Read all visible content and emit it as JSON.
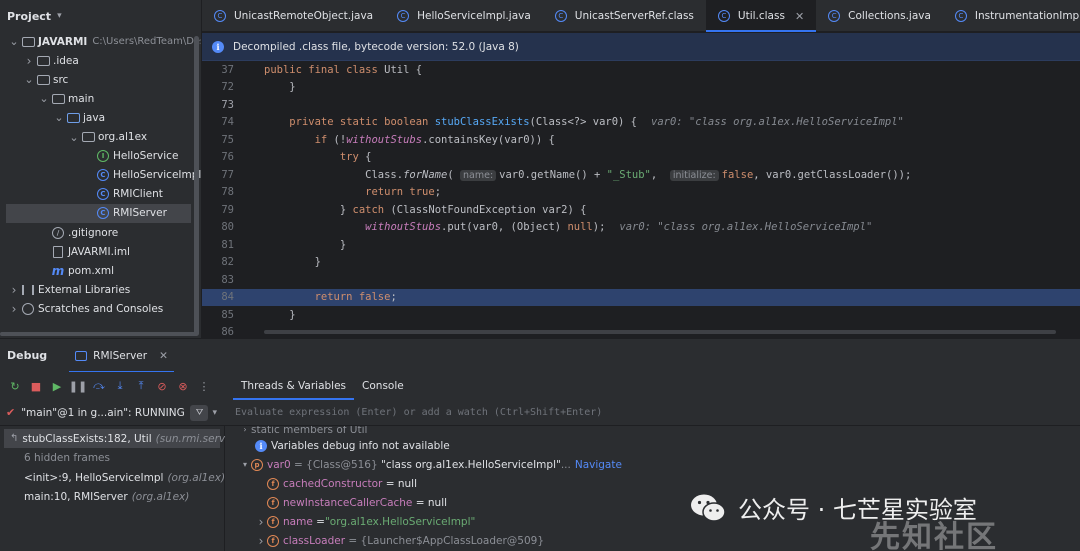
{
  "project": {
    "title": "Project",
    "tree": [
      {
        "label": "JAVARMI",
        "path": "C:\\Users\\RedTeam\\Desk",
        "icon": "folder-icon",
        "indent": 0,
        "arrow": "down"
      },
      {
        "label": ".idea",
        "icon": "folder-icon",
        "indent": 1,
        "arrow": "right"
      },
      {
        "label": "src",
        "icon": "folder-icon",
        "indent": 1,
        "arrow": "down"
      },
      {
        "label": "main",
        "icon": "folder-icon",
        "indent": 2,
        "arrow": "down"
      },
      {
        "label": "java",
        "icon": "source-folder-icon",
        "indent": 3,
        "arrow": "down"
      },
      {
        "label": "org.al1ex",
        "icon": "package-icon",
        "indent": 4,
        "arrow": "down"
      },
      {
        "label": "HelloService",
        "icon": "interface-icon",
        "indent": 5,
        "arrow": ""
      },
      {
        "label": "HelloServiceImpl",
        "icon": "class-icon",
        "indent": 5,
        "arrow": ""
      },
      {
        "label": "RMIClient",
        "icon": "class-icon",
        "indent": 5,
        "arrow": ""
      },
      {
        "label": "RMIServer",
        "icon": "class-icon",
        "indent": 5,
        "arrow": "",
        "selected": true
      },
      {
        "label": ".gitignore",
        "icon": "gitignore-icon",
        "indent": 2,
        "arrow": ""
      },
      {
        "label": "JAVARMI.iml",
        "icon": "file-icon",
        "indent": 2,
        "arrow": ""
      },
      {
        "label": "pom.xml",
        "icon": "maven-icon",
        "indent": 2,
        "arrow": ""
      },
      {
        "label": "External Libraries",
        "icon": "library-icon",
        "indent": 0,
        "arrow": "right"
      },
      {
        "label": "Scratches and Consoles",
        "icon": "scratches-icon",
        "indent": 0,
        "arrow": "right"
      }
    ]
  },
  "tabs": [
    {
      "label": "UnicastRemoteObject.java"
    },
    {
      "label": "HelloServiceImpl.java"
    },
    {
      "label": "UnicastServerRef.class"
    },
    {
      "label": "Util.class",
      "active": true
    },
    {
      "label": "Collections.java"
    },
    {
      "label": "InstrumentationImpl.class"
    }
  ],
  "banner": {
    "text": "Decompiled .class file, bytecode version: 52.0 (Java 8)"
  },
  "editor": {
    "lines": [
      {
        "n": "37",
        "html": "<span class='kw'>public final class</span> Util {"
      },
      {
        "n": "72",
        "html": "    }"
      },
      {
        "n": "73",
        "html": "",
        "current": true
      },
      {
        "n": "74",
        "html": "    <span class='kw'>private static boolean</span> <span class='fn'>stubClassExists</span>(Class&lt;?&gt; var0) {<span class='hint'>var0: \"class org.al1ex.HelloServiceImpl\"</span>"
      },
      {
        "n": "75",
        "html": "        <span class='kw'>if</span> (!<span class='fld'>withoutStubs</span>.containsKey(var0)) {"
      },
      {
        "n": "76",
        "html": "            <span class='kw'>try</span> {"
      },
      {
        "n": "77",
        "html": "                Class.<span class='it'>forName</span>( <span class='phint'>name:</span>var0.getName() + <span class='st'>\"_Stub\"</span>,  <span class='phint'>initialize:</span><span class='kw'>false</span>, var0.getClassLoader());"
      },
      {
        "n": "78",
        "html": "                <span class='kw'>return true</span>;"
      },
      {
        "n": "79",
        "html": "            } <span class='kw'>catch</span> (ClassNotFoundException var2) {"
      },
      {
        "n": "80",
        "html": "                <span class='fld'>withoutStubs</span>.put(var0, (Object) <span class='kw'>null</span>);<span class='hint'>var0: \"class org.al1ex.HelloServiceImpl\"</span>"
      },
      {
        "n": "81",
        "html": "            }"
      },
      {
        "n": "82",
        "html": "        }"
      },
      {
        "n": "83",
        "html": ""
      },
      {
        "n": "84",
        "html": "        <span class='kw'>return false</span>;",
        "highlight": true
      },
      {
        "n": "85",
        "html": "    }"
      },
      {
        "n": "86",
        "html": ""
      }
    ]
  },
  "debug": {
    "title": "Debug",
    "config": "RMIServer",
    "tabs": [
      "Threads & Variables",
      "Console"
    ],
    "thread": "\"main\"@1 in g...ain\": RUNNING",
    "eval_placeholder": "Evaluate expression (Enter) or add a watch (Ctrl+Shift+Enter)",
    "frames": [
      {
        "method": "stubClassExists:182, Util",
        "pkg": "(sun.rmi.server)",
        "selected": true
      },
      {
        "method": "6 hidden frames",
        "pkg": "",
        "dim": true
      },
      {
        "method": "<init>:9, HelloServiceImpl",
        "pkg": "(org.al1ex)"
      },
      {
        "method": "main:10, RMIServer",
        "pkg": "(org.al1ex)"
      }
    ],
    "variables": {
      "static_members": "static members of Util",
      "info": "Variables debug info not available",
      "var0_name": "var0",
      "var0_type": "= {Class@516}",
      "var0_value": "\"class org.al1ex.HelloServiceImpl\"",
      "var0_ellipsis": "...",
      "navigate": "Navigate",
      "children": [
        {
          "name": "cachedConstructor",
          "value": "= null"
        },
        {
          "name": "newInstanceCallerCache",
          "value": "= null"
        },
        {
          "name": "name",
          "value": "= \"org.al1ex.HelloServiceImpl\"",
          "expandable": true
        },
        {
          "name": "classLoader",
          "value": "= {Launcher$AppClassLoader@509}",
          "expandable": true
        }
      ]
    }
  },
  "watermark": {
    "text": "公众号 · 七芒星实验室",
    "text2": "先知社区"
  }
}
